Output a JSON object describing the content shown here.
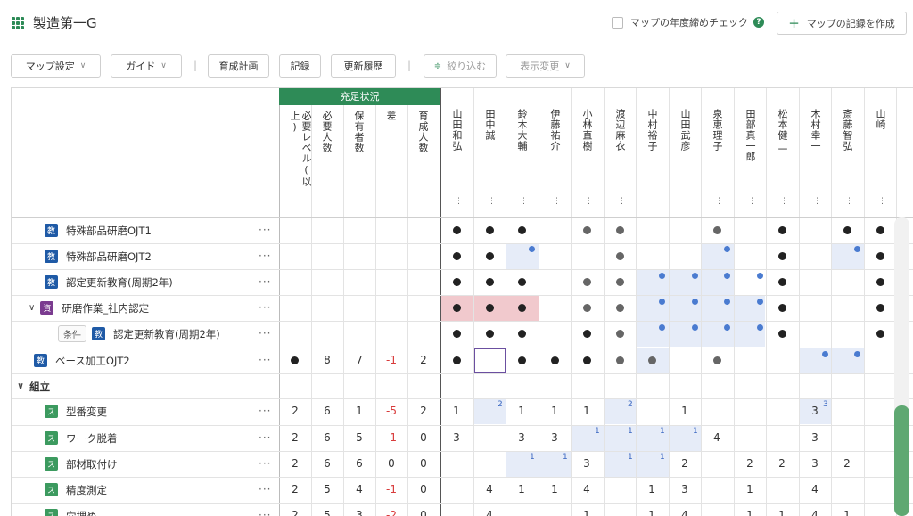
{
  "header": {
    "title": "製造第一G",
    "check_label": "マップの年度締めチェック",
    "create_button": "マップの記録を作成"
  },
  "toolbar": {
    "map_settings": "マップ設定",
    "guide": "ガイド",
    "training_plan": "育成計画",
    "record": "記録",
    "history": "更新履歴",
    "filter": "絞り込む",
    "display_change": "表示変更",
    "separator": "|"
  },
  "table": {
    "group_header": "充足状況",
    "stat_columns": [
      "必要レベル(以上)",
      "必要人数",
      "保有者数",
      "差",
      "育成人数"
    ],
    "people": [
      "山田和弘",
      "田中誠",
      "鈴木大輔",
      "伊藤祐介",
      "小林直樹",
      "渡辺麻衣",
      "中村裕子",
      "山田武彦",
      "泉恵理子",
      "田部真一郎",
      "松本健二",
      "木村幸一",
      "斎藤智弘",
      "山崎一"
    ],
    "kebab": "⋮",
    "row_menu": "···",
    "condition_label": "条件",
    "caret_open": "∨",
    "rows": [
      {
        "badge": "教",
        "kind": "edu",
        "label": "特殊部品研磨OJT1",
        "indent": 0
      },
      {
        "badge": "教",
        "kind": "edu",
        "label": "特殊部品研磨OJT2",
        "indent": 0
      },
      {
        "badge": "教",
        "kind": "edu",
        "label": "認定更新教育(周期2年)",
        "indent": 0
      },
      {
        "badge": "資",
        "kind": "qual",
        "label": "研磨作業_社内認定",
        "indent": 0,
        "caret": true
      },
      {
        "badge": "教",
        "kind": "edu",
        "label": "認定更新教育(周期2年)",
        "indent": 1,
        "condition": true
      },
      {
        "badge": "教",
        "kind": "edu",
        "label": "ベース加工OJT2",
        "indent": -1,
        "stats": [
          "●",
          "8",
          "7",
          "-1",
          "2"
        ]
      },
      {
        "section": "組立"
      },
      {
        "badge": "ス",
        "kind": "skill",
        "label": "型番変更",
        "stats": [
          "2",
          "6",
          "1",
          "-5",
          "2"
        ]
      },
      {
        "badge": "ス",
        "kind": "skill",
        "label": "ワーク脱着",
        "stats": [
          "2",
          "6",
          "5",
          "-1",
          "0"
        ]
      },
      {
        "badge": "ス",
        "kind": "skill",
        "label": "部材取付け",
        "stats": [
          "2",
          "6",
          "6",
          "0",
          "0"
        ]
      },
      {
        "badge": "ス",
        "kind": "skill",
        "label": "精度測定",
        "stats": [
          "2",
          "5",
          "4",
          "-1",
          "0"
        ]
      },
      {
        "badge": "ス",
        "kind": "skill",
        "label": "穴埋め",
        "stats": [
          "2",
          "5",
          "3",
          "-2",
          "0"
        ]
      }
    ],
    "cell_values": {
      "r7": {
        "0": "1",
        "2": "1",
        "3": "1",
        "4": "1",
        "7": "1",
        "11": "3"
      },
      "r8": {
        "0": "3",
        "2": "3",
        "3": "3",
        "8": "4",
        "11": "3"
      },
      "r9": {
        "4": "3",
        "7": "2",
        "9": "2",
        "10": "2",
        "11": "3",
        "12": "2"
      },
      "r10": {
        "1": "4",
        "2": "1",
        "3": "1",
        "4": "4",
        "6": "1",
        "7": "3",
        "9": "1",
        "11": "4"
      },
      "r11": {
        "1": "4",
        "4": "1",
        "6": "1",
        "7": "4",
        "9": "1",
        "10": "1",
        "11": "4",
        "12": "1"
      }
    },
    "superscripts": {
      "r7": {
        "1": "2",
        "5": "2",
        "11": "3"
      },
      "r8": {
        "4": "1",
        "5": "1",
        "6": "1",
        "7": "1"
      },
      "r9": {
        "2": "1",
        "3": "1",
        "5": "1",
        "6": "1"
      }
    }
  }
}
